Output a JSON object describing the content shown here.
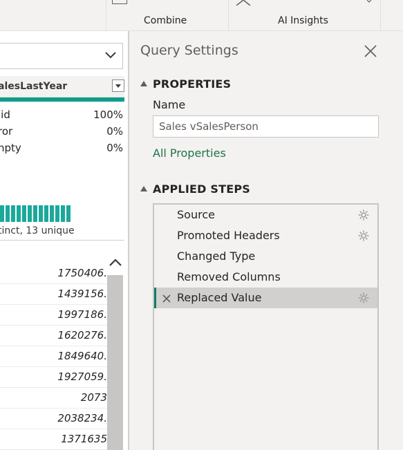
{
  "ribbon": {
    "groups": [
      "Combine",
      "AI Insights"
    ]
  },
  "preview": {
    "column_header": "alesLastYear",
    "quality": [
      {
        "label": "lid",
        "value": "100%"
      },
      {
        "label": "ror",
        "value": "0%"
      },
      {
        "label": "npty",
        "value": "0%"
      }
    ],
    "distinct_text": "tinct, 13 unique",
    "histogram_bars": 13,
    "rows": [
      "1750406.",
      "1439156.",
      "1997186.",
      "1620276.",
      "1849640.",
      "1927059.",
      "2073",
      "2038234.",
      "1371635"
    ]
  },
  "query_settings": {
    "title": "Query Settings",
    "properties_title": "PROPERTIES",
    "name_label": "Name",
    "name_value": "Sales vSalesPerson",
    "all_properties": "All Properties",
    "applied_steps_title": "APPLIED STEPS",
    "steps": [
      {
        "label": "Source",
        "gear": true
      },
      {
        "label": "Promoted Headers",
        "gear": true
      },
      {
        "label": "Changed Type",
        "gear": false
      },
      {
        "label": "Removed Columns",
        "gear": false
      },
      {
        "label": "Replaced Value",
        "gear": true,
        "selected": true
      }
    ]
  },
  "colors": {
    "accent_teal": "#0f9d8a",
    "link_green": "#217346",
    "pane_bg": "#f3f2f1"
  }
}
